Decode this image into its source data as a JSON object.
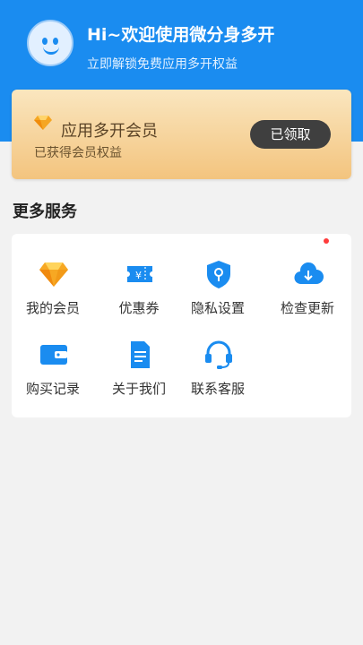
{
  "header": {
    "greeting": "Hi~欢迎使用微分身多开",
    "subtitle": "立即解锁免费应用多开权益"
  },
  "vip_card": {
    "title": "应用多开会员",
    "subtitle": "已获得会员权益",
    "button_label": "已领取"
  },
  "section": {
    "title": "更多服务"
  },
  "services": [
    {
      "label": "我的会员",
      "icon": "diamond-icon"
    },
    {
      "label": "优惠券",
      "icon": "coupon-icon"
    },
    {
      "label": "隐私设置",
      "icon": "shield-lock-icon"
    },
    {
      "label": "检查更新",
      "icon": "cloud-download-icon"
    },
    {
      "label": "购买记录",
      "icon": "wallet-icon"
    },
    {
      "label": "关于我们",
      "icon": "document-icon"
    },
    {
      "label": "联系客服",
      "icon": "headset-icon"
    }
  ],
  "colors": {
    "primary": "#1a8cf0",
    "gold": "#f3c47e",
    "badge_dot": "#ff3b3b"
  }
}
